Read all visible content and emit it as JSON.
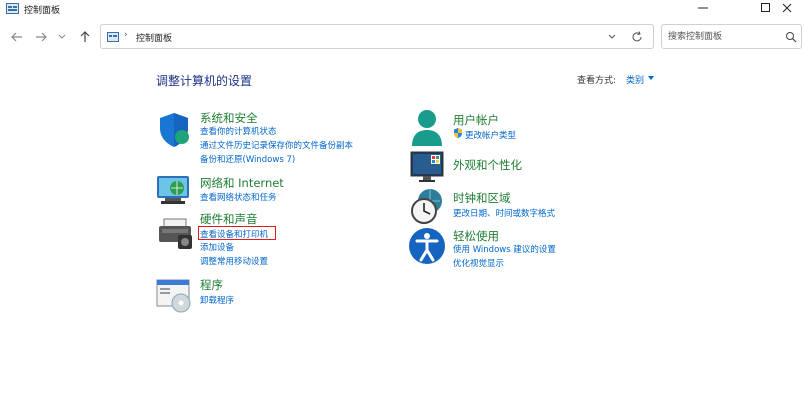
{
  "window": {
    "title": "控制面板"
  },
  "navigation": {
    "breadcrumb_separator": "›",
    "address_text": "控制面板",
    "search_placeholder": "搜索控制面板"
  },
  "content": {
    "heading": "调整计算机的设置",
    "view_by_label": "查看方式:",
    "view_by_value": "类别"
  },
  "categories": {
    "system_security": {
      "title": "系统和安全",
      "links": [
        "查看你的计算机状态",
        "通过文件历史记录保存你的文件备份副本",
        "备份和还原(Windows 7)"
      ]
    },
    "network": {
      "title": "网络和 Internet",
      "links": [
        "查看网络状态和任务"
      ]
    },
    "hardware": {
      "title": "硬件和声音",
      "links": [
        "查看设备和打印机",
        "添加设备",
        "调整常用移动设置"
      ]
    },
    "programs": {
      "title": "程序",
      "links": [
        "卸载程序"
      ]
    },
    "user_accounts": {
      "title": "用户帐户",
      "links": [
        "更改帐户类型"
      ]
    },
    "appearance": {
      "title": "外观和个性化",
      "links": []
    },
    "clock_region": {
      "title": "时钟和区域",
      "links": [
        "更改日期、时间或数字格式"
      ]
    },
    "ease_access": {
      "title": "轻松使用",
      "links": [
        "使用 Windows 建议的设置",
        "优化视觉显示"
      ]
    }
  },
  "colors": {
    "category_title": "#1e7e34",
    "link": "#0066cc",
    "heading": "#1e3287",
    "highlight_box": "#e01c1c"
  }
}
